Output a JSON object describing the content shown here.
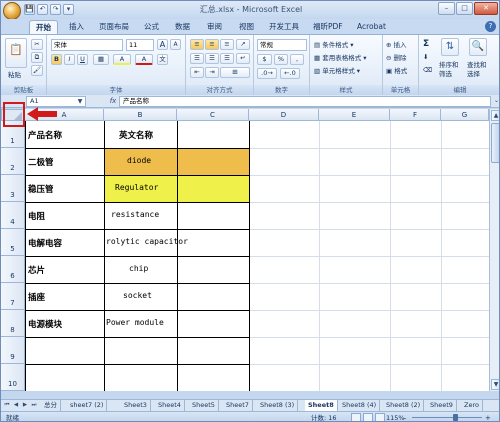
{
  "app": {
    "title": "汇总.xlsx - Microsoft Excel",
    "window_buttons": [
      "–",
      "□",
      "✕"
    ]
  },
  "qat": [
    "💾",
    "↶",
    "↷",
    "▾"
  ],
  "tabs": [
    "开始",
    "插入",
    "页面布局",
    "公式",
    "数据",
    "审阅",
    "视图",
    "开发工具",
    "福昕PDF",
    "Acrobat"
  ],
  "ribbon": {
    "clipboard": {
      "label": "剪贴板",
      "paste": "粘贴"
    },
    "font": {
      "label": "字体",
      "name": "宋体",
      "size": "11",
      "bold": "B",
      "italic": "I",
      "underline": "U",
      "grow": "A",
      "shrink": "A",
      "fill_color": "A",
      "font_color": "A"
    },
    "alignment": {
      "label": "对齐方式"
    },
    "number": {
      "label": "数字",
      "format": "常规",
      "percent": "%",
      "comma": ",",
      "currency": "$"
    },
    "styles": {
      "label": "样式",
      "conditional": "条件格式",
      "table": "套用表格格式",
      "cell_styles": "单元格样式"
    },
    "cells": {
      "label": "单元格",
      "insert": "插入",
      "delete": "删除",
      "format": "格式"
    },
    "editing": {
      "label": "编辑",
      "sort": "排序和",
      "sort2": "筛选",
      "find": "查找和",
      "find2": "选择",
      "sum": "Σ"
    }
  },
  "formula_bar": {
    "name_box": "A1",
    "fx": "fx",
    "value": "产品名称"
  },
  "columns": [
    "A",
    "B",
    "C",
    "D",
    "E",
    "F",
    "G"
  ],
  "rows": [
    "1",
    "2",
    "3",
    "4",
    "5",
    "6",
    "7",
    "8",
    "9",
    "10"
  ],
  "cells": {
    "r1": [
      "产品名称",
      "英文名称"
    ],
    "r2": [
      "二极管",
      "diode"
    ],
    "r3": [
      "稳压管",
      "Regulator"
    ],
    "r4": [
      "电阻",
      "resistance"
    ],
    "r5": [
      "电解电容",
      "rolytic capacitor"
    ],
    "r6": [
      "芯片",
      "chip"
    ],
    "r7": [
      "插座",
      "socket"
    ],
    "r8": [
      "电源模块",
      "Power module"
    ]
  },
  "colors": {
    "fill_orange": "#efbd4c",
    "fill_yellow": "#f0f04a",
    "annotation_red": "#d11a1a"
  },
  "sheet_tabs": [
    "总分",
    "sheet7 (2)",
    "Sheet3",
    "Sheet4",
    "Sheet5",
    "Sheet7",
    "Sheet8 (3)",
    "Sheet8",
    "Sheet8 (4)",
    "Sheet8 (2)",
    "Sheet9",
    "Zero"
  ],
  "active_sheet": "Sheet8",
  "status": {
    "ready": "就绪",
    "count": "计数: 16",
    "zoom": "115%",
    "zoom_minus": "–",
    "zoom_plus": "+"
  }
}
